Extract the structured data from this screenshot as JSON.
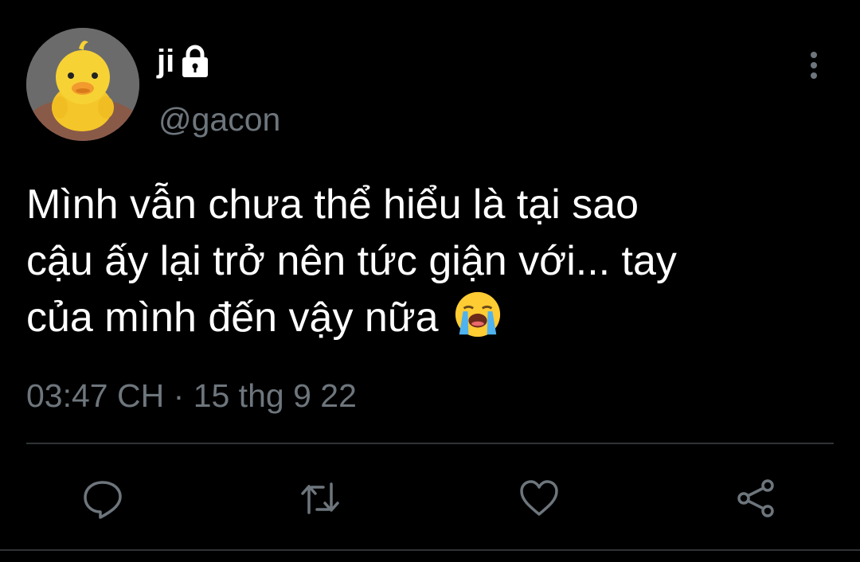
{
  "user": {
    "display_name": "ji",
    "handle": "@gacon",
    "avatar_icon": "yellow-duck-avatar",
    "protected_icon": "lock-icon"
  },
  "tweet": {
    "lines": [
      "Mình vẫn chưa thể hiểu là tại sao",
      "cậu ấy lại trở nên tức giận với... tay",
      "của mình đến vậy nữa"
    ],
    "emoji": "loudly-crying-face-emoji"
  },
  "meta": {
    "time": "03:47 CH",
    "separator": "·",
    "date": "15 thg 9 22"
  },
  "actions": [
    {
      "name": "reply",
      "icon": "comment-bubble-icon"
    },
    {
      "name": "retweet",
      "icon": "retweet-arrows-icon"
    },
    {
      "name": "like",
      "icon": "heart-icon"
    },
    {
      "name": "share",
      "icon": "share-nodes-icon"
    }
  ],
  "colors": {
    "background": "#000000",
    "text": "#ffffff",
    "secondary": "#6e767d",
    "divider": "#2f3336"
  }
}
